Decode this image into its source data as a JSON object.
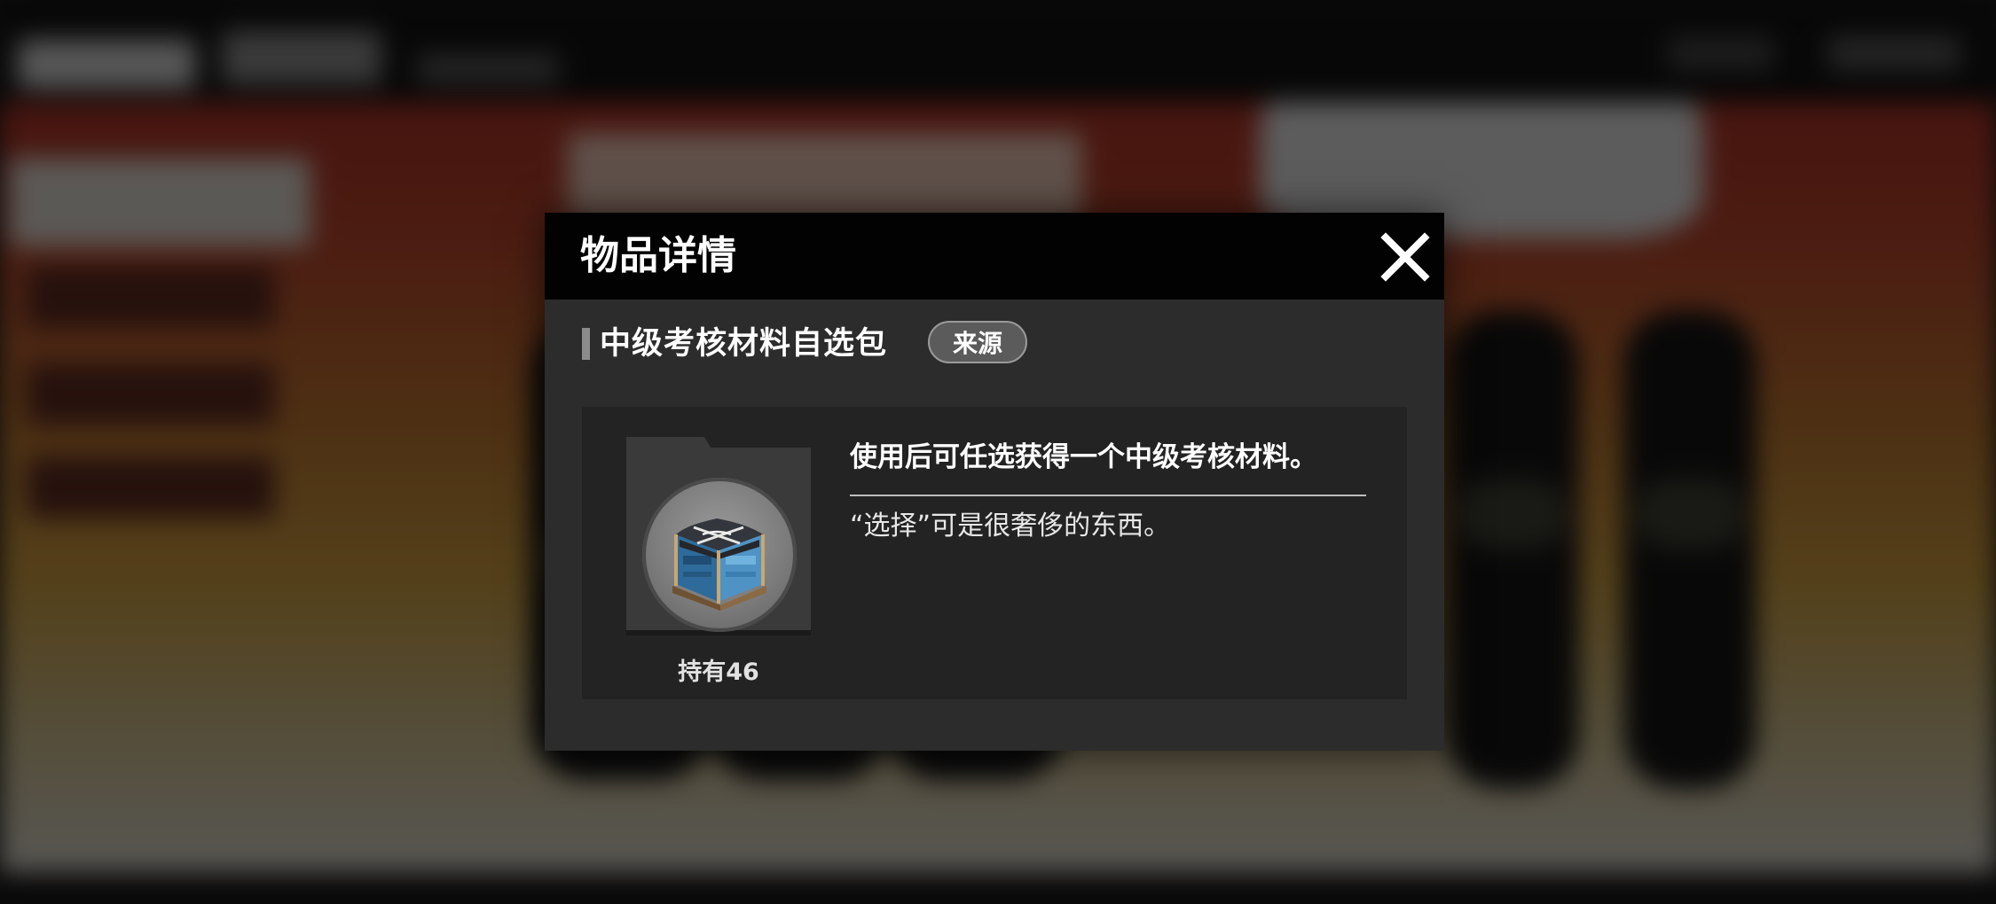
{
  "modal": {
    "title": "物品详情",
    "close_icon": "close-icon"
  },
  "item": {
    "name": "中级考核材料自选包",
    "source_label": "来源",
    "icon": "supply-crate-icon",
    "owned": "持有46",
    "description": "使用后可任选获得一个中级考核材料。",
    "flavor": "“选择”可是很奢侈的东西。"
  },
  "colors": {
    "header_bg": "#020202",
    "modal_bg": "#2c2c2c",
    "panel_bg": "#232323",
    "source_button_bg": "#5b5b5b",
    "text": "#ffffff"
  }
}
